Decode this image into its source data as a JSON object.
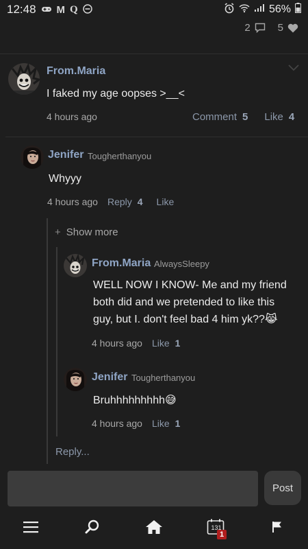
{
  "status_bar": {
    "time": "12:48",
    "battery": "56%"
  },
  "post_counts": {
    "comments": "2",
    "likes": "5"
  },
  "main_comment": {
    "author": "From.Maria",
    "text": "I faked my age oopses >__<",
    "time": "4 hours ago",
    "comment_label": "Comment",
    "comment_count": "5",
    "like_label": "Like",
    "like_count": "4"
  },
  "reply1": {
    "author": "Jenifer",
    "handle": "Tougherthanyou",
    "text": "Whyyy",
    "time": "4 hours ago",
    "reply_label": "Reply",
    "reply_count": "4",
    "like_label": "Like"
  },
  "show_more": "Show more",
  "nested1": {
    "author": "From.Maria",
    "handle": "AlwaysSleepy",
    "text_lines": [
      "WELL NOW I KNOW- Me and my friend",
      "both did and we pretended to like this",
      "guy, but I. don't feel bad 4 him yk??😹"
    ],
    "time": "4 hours ago",
    "like_label": "Like",
    "like_count": "1"
  },
  "nested2": {
    "author": "Jenifer",
    "handle": "Tougherthanyou",
    "text": "Bruhhhhhhhhh😅",
    "time": "4 hours ago",
    "like_label": "Like",
    "like_count": "1"
  },
  "reply_link": "Reply...",
  "composer": {
    "placeholder": "",
    "post_label": "Post"
  },
  "nav": {
    "calendar_number": "131",
    "badge": "1"
  },
  "colors": {
    "background": "#1e1e1e",
    "author_name": "#8fa5c5",
    "badge": "#b01e1e"
  }
}
